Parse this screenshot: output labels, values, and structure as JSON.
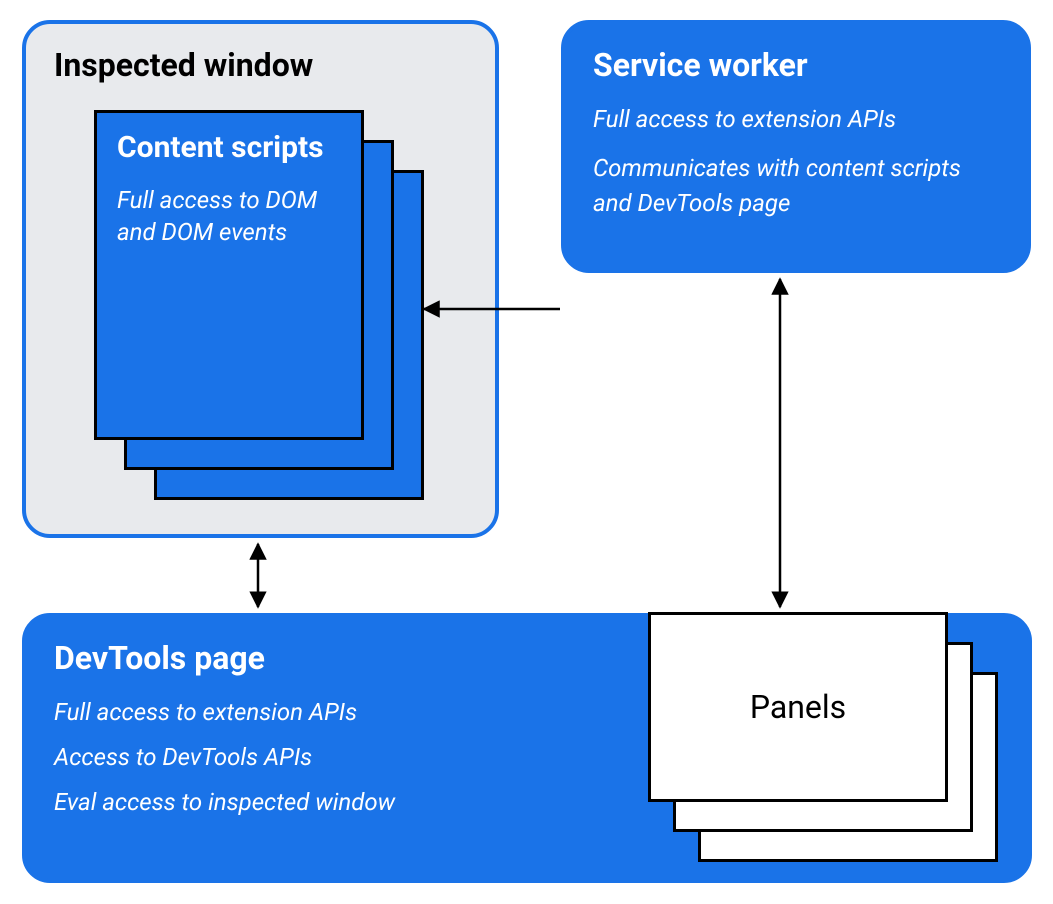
{
  "inspected_window": {
    "title": "Inspected window",
    "content_scripts": {
      "title": "Content scripts",
      "desc": "Full access to DOM and DOM events"
    }
  },
  "service_worker": {
    "title": "Service worker",
    "desc1": "Full access to extension APIs",
    "desc2": "Communicates with content scripts and DevTools page"
  },
  "devtools_page": {
    "title": "DevTools page",
    "desc1": "Full access to extension APIs",
    "desc2": "Access to DevTools APIs",
    "desc3": "Eval access to inspected window",
    "panels_label": "Panels"
  }
}
